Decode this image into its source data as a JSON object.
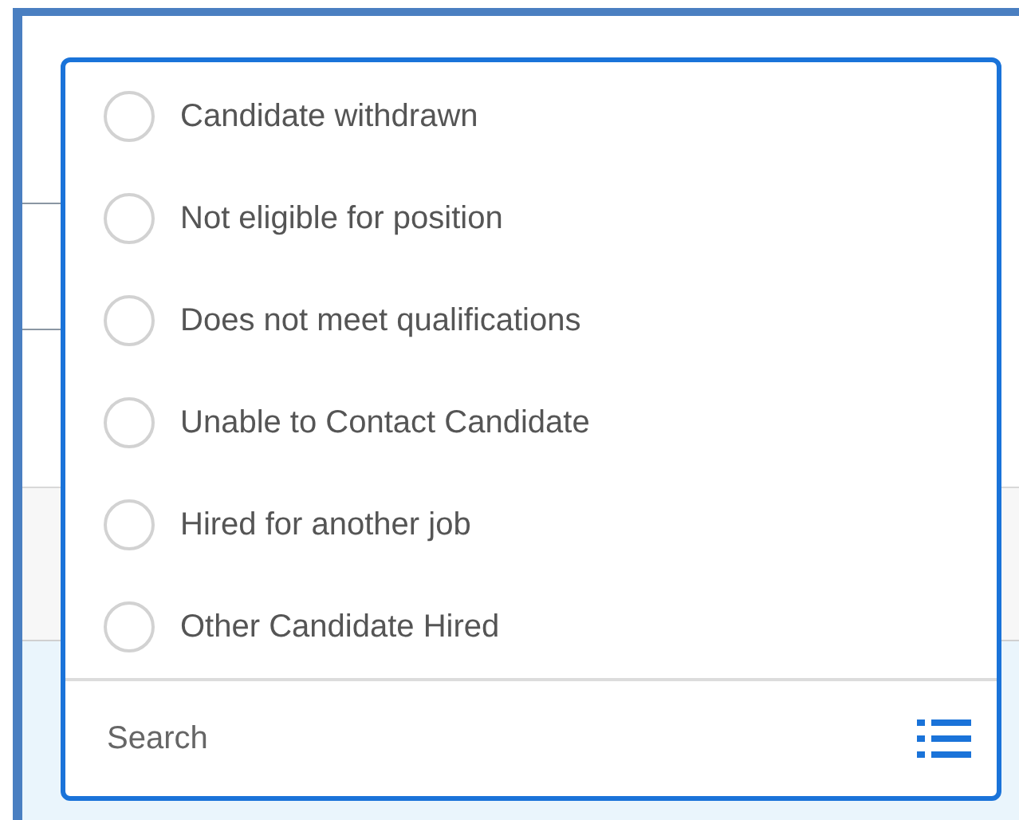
{
  "options": [
    {
      "label": "Candidate withdrawn",
      "selected": false
    },
    {
      "label": "Not eligible for position",
      "selected": false
    },
    {
      "label": "Does not meet qualifications",
      "selected": false
    },
    {
      "label": "Unable to Contact Candidate",
      "selected": false
    },
    {
      "label": "Hired for another job",
      "selected": false
    },
    {
      "label": "Other Candidate Hired",
      "selected": false
    }
  ],
  "search": {
    "placeholder": "Search"
  }
}
